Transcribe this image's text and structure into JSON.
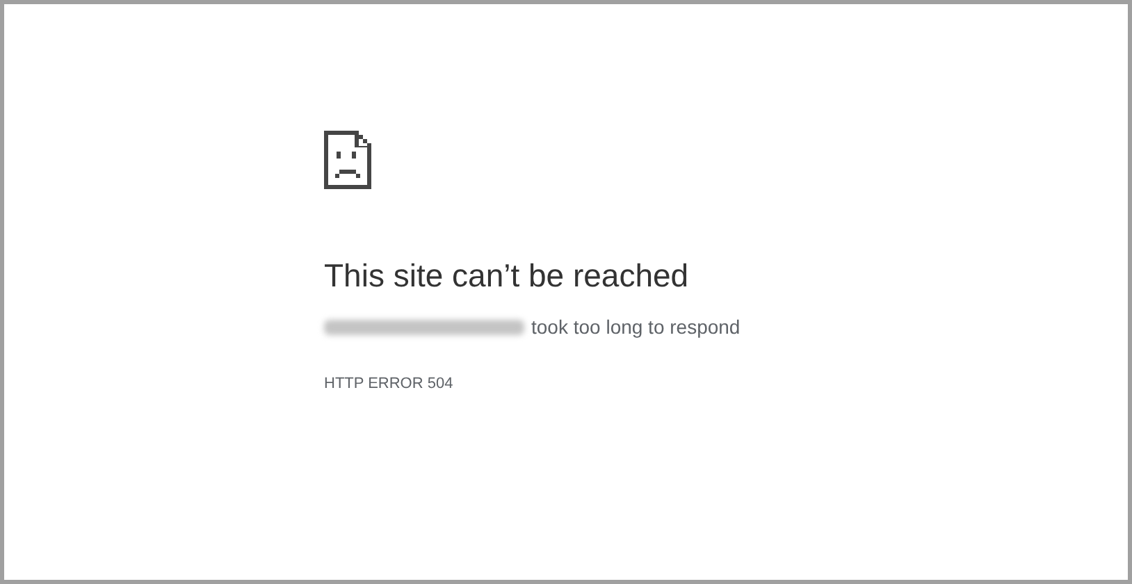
{
  "error_page": {
    "title": "This site can’t be reached",
    "message": "took too long to respond",
    "error_code": "HTTP ERROR 504"
  }
}
